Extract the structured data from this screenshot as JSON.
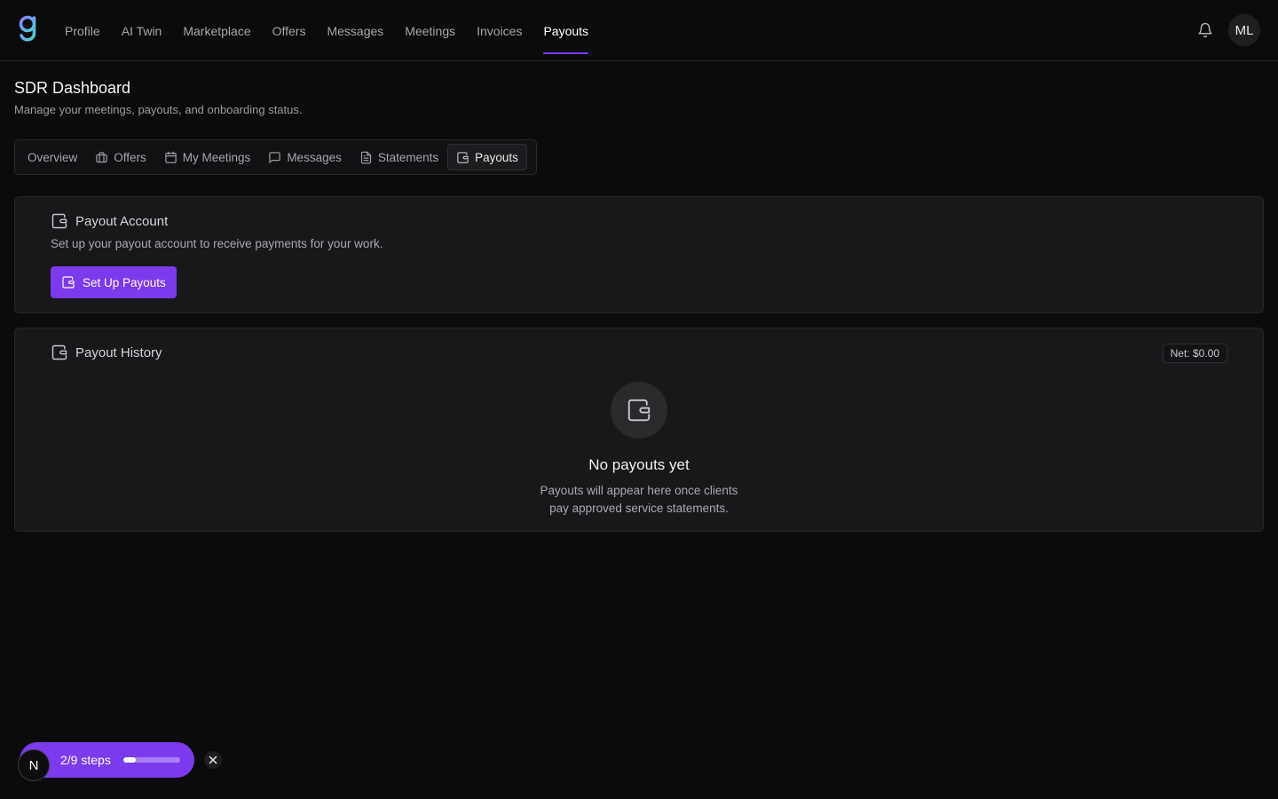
{
  "nav": {
    "items": [
      {
        "label": "Profile"
      },
      {
        "label": "AI Twin"
      },
      {
        "label": "Marketplace"
      },
      {
        "label": "Offers"
      },
      {
        "label": "Messages"
      },
      {
        "label": "Meetings"
      },
      {
        "label": "Invoices"
      },
      {
        "label": "Payouts",
        "active": true
      }
    ],
    "avatar_initials": "ML",
    "logo_icon": "g-logo-icon",
    "bell_icon": "bell-icon"
  },
  "header": {
    "title": "SDR Dashboard",
    "subtitle": "Manage your meetings, payouts, and onboarding status."
  },
  "tabs": [
    {
      "label": "Overview",
      "icon": ""
    },
    {
      "label": "Offers",
      "icon": "briefcase-icon"
    },
    {
      "label": "My Meetings",
      "icon": "calendar-icon"
    },
    {
      "label": "Messages",
      "icon": "message-square-icon"
    },
    {
      "label": "Statements",
      "icon": "file-text-icon"
    },
    {
      "label": "Payouts",
      "icon": "wallet-icon",
      "active": true
    }
  ],
  "payout_account": {
    "title": "Payout Account",
    "description": "Set up your payout account to receive payments for your work.",
    "button_label": "Set Up Payouts"
  },
  "payout_history": {
    "title": "Payout History",
    "net_badge": "Net: $0.00",
    "empty_title": "No payouts yet",
    "empty_description": "Payouts will appear here once clients pay approved service statements."
  },
  "onboarding": {
    "avatar_letter": "N",
    "steps_label": "2/9 steps",
    "progress": 0.22
  },
  "colors": {
    "accent": "#7c3aed",
    "background": "#0b0b0c",
    "card": "#18181a"
  }
}
